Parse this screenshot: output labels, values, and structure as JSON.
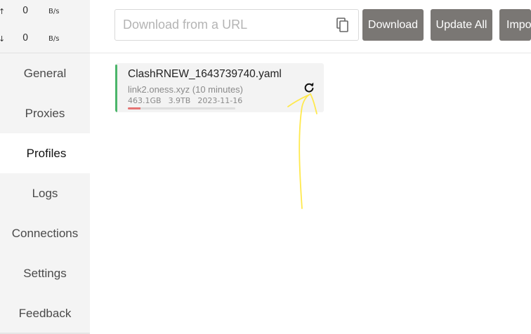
{
  "sidebar": {
    "speed": {
      "upload": {
        "arrow": "↑",
        "value": "0",
        "unit": "B/s"
      },
      "download": {
        "arrow": "↓",
        "value": "0",
        "unit": "B/s"
      }
    },
    "items": [
      {
        "label": "General"
      },
      {
        "label": "Proxies"
      },
      {
        "label": "Profiles",
        "active": true
      },
      {
        "label": "Logs"
      },
      {
        "label": "Connections"
      },
      {
        "label": "Settings"
      },
      {
        "label": "Feedback"
      }
    ]
  },
  "toolbar": {
    "url_value": "",
    "url_placeholder": "Download from a URL",
    "paste_icon": "paste-icon",
    "download_label": "Download",
    "update_all_label": "Update All",
    "import_label": "Import"
  },
  "profiles": [
    {
      "name": "ClashRNEW_1643739740.yaml",
      "source": "link2.oness.xyz (10 minutes)",
      "used": "463.1GB",
      "total": "3.9TB",
      "expires": "2023-11-16",
      "usage_fraction": 0.116,
      "refresh_icon": "refresh-icon"
    }
  ],
  "colors": {
    "sidebar_bg": "#f4f4f4",
    "button_bg": "#7a7774",
    "active_accent": "#4bb56a",
    "usage_bar": "#e57373",
    "annotation": "#ffe94d"
  }
}
